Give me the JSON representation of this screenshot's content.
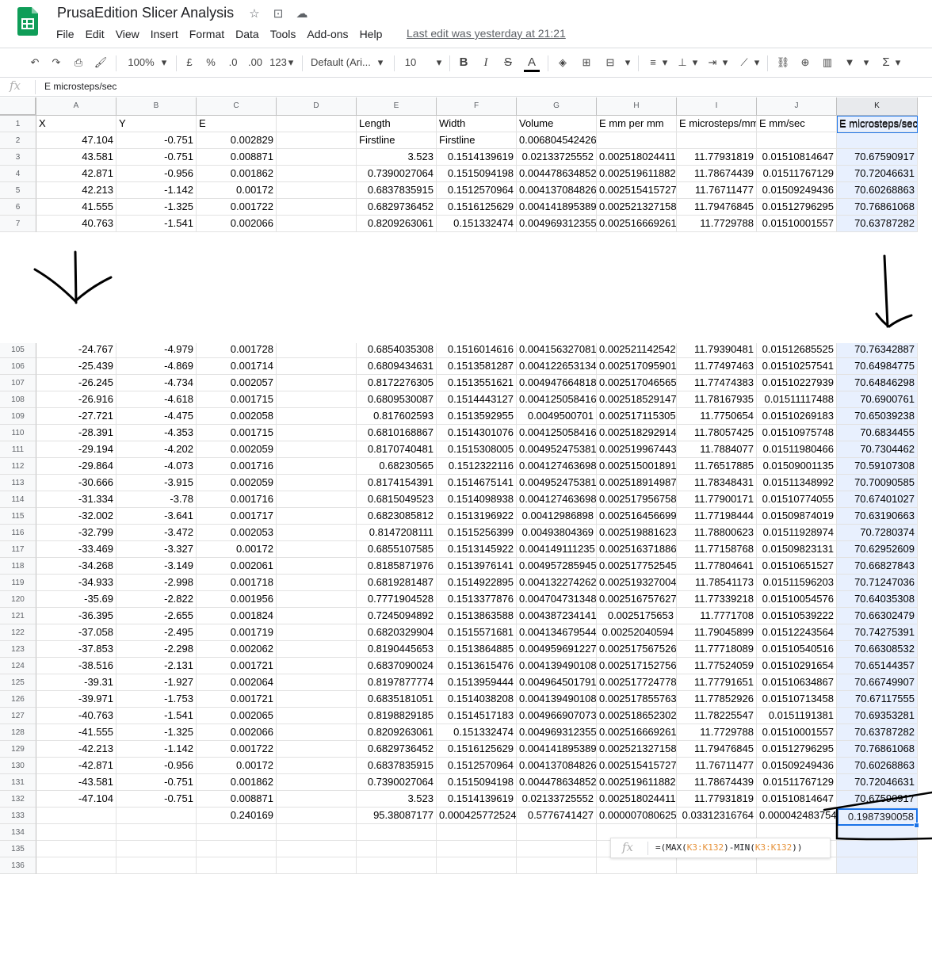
{
  "app": {
    "title": "PrusaEdition Slicer Analysis",
    "last_edit": "Last edit was yesterday at 21:21",
    "menu": [
      "File",
      "Edit",
      "View",
      "Insert",
      "Format",
      "Data",
      "Tools",
      "Add-ons",
      "Help"
    ],
    "title_icons": [
      "star-icon",
      "move-to-folder-icon",
      "cloud-status-icon"
    ]
  },
  "toolbar": {
    "zoom": "100%",
    "currency": "£",
    "percent": "%",
    "dec_less": ".0",
    "dec_more": ".00",
    "more_formats": "123",
    "font": "Default (Ari...",
    "font_size": "10",
    "bold": "B",
    "italic": "I",
    "strike": "S",
    "text_color": "A",
    "sum": "Σ"
  },
  "formula_bar": {
    "fx": "fx",
    "content": "E microsteps/sec"
  },
  "columns": [
    "A",
    "B",
    "C",
    "D",
    "E",
    "F",
    "G",
    "H",
    "I",
    "J",
    "K"
  ],
  "selected_column": "K",
  "header_row": {
    "num": "1",
    "cells": [
      "X",
      "Y",
      "E",
      "",
      "Length",
      "Width",
      "Volume",
      "E mm per mm",
      "E microsteps/mm",
      "E mm/sec",
      "E microsteps/sec"
    ]
  },
  "row2": {
    "num": "2",
    "cells": [
      "47.104",
      "-0.751",
      "0.002829",
      "",
      "Firstline",
      "Firstline",
      "0.006804542426",
      "",
      "",
      "",
      ""
    ]
  },
  "top_rows": [
    {
      "num": "3",
      "cells": [
        "43.581",
        "-0.751",
        "0.008871",
        "",
        "3.523",
        "0.1514139619",
        "0.02133725552",
        "0.002518024411",
        "11.77931819",
        "0.01510814647",
        "70.67590917"
      ]
    },
    {
      "num": "4",
      "cells": [
        "42.871",
        "-0.956",
        "0.001862",
        "",
        "0.7390027064",
        "0.1515094198",
        "0.004478634852",
        "0.002519611882",
        "11.78674439",
        "0.01511767129",
        "70.72046631"
      ]
    },
    {
      "num": "5",
      "cells": [
        "42.213",
        "-1.142",
        "0.00172",
        "",
        "0.6837835915",
        "0.1512570964",
        "0.004137084826",
        "0.002515415727",
        "11.76711477",
        "0.01509249436",
        "70.60268863"
      ]
    },
    {
      "num": "6",
      "cells": [
        "41.555",
        "-1.325",
        "0.001722",
        "",
        "0.6829736452",
        "0.1516125629",
        "0.004141895389",
        "0.002521327158",
        "11.79476845",
        "0.01512796295",
        "70.76861068"
      ]
    },
    {
      "num": "7",
      "cells": [
        "40.763",
        "-1.541",
        "0.002066",
        "",
        "0.8209263061",
        "0.151332474",
        "0.004969312355",
        "0.002516669261",
        "11.7729788",
        "0.01510001557",
        "70.63787282"
      ]
    }
  ],
  "bottom_rows": [
    {
      "num": "105",
      "cells": [
        "-24.767",
        "-4.979",
        "0.001728",
        "",
        "0.6854035308",
        "0.1516014616",
        "0.004156327081",
        "0.002521142542",
        "11.79390481",
        "0.01512685525",
        "70.76342887"
      ]
    },
    {
      "num": "106",
      "cells": [
        "-25.439",
        "-4.869",
        "0.001714",
        "",
        "0.6809434631",
        "0.1513581287",
        "0.004122653134",
        "0.002517095901",
        "11.77497463",
        "0.01510257541",
        "70.64984775"
      ]
    },
    {
      "num": "107",
      "cells": [
        "-26.245",
        "-4.734",
        "0.002057",
        "",
        "0.8172276305",
        "0.1513551621",
        "0.004947664818",
        "0.002517046565",
        "11.77474383",
        "0.01510227939",
        "70.64846298"
      ]
    },
    {
      "num": "108",
      "cells": [
        "-26.916",
        "-4.618",
        "0.001715",
        "",
        "0.6809530087",
        "0.1514443127",
        "0.004125058416",
        "0.002518529147",
        "11.78167935",
        "0.01511117488",
        "70.6900761"
      ]
    },
    {
      "num": "109",
      "cells": [
        "-27.721",
        "-4.475",
        "0.002058",
        "",
        "0.817602593",
        "0.1513592955",
        "0.0049500701",
        "0.002517115305",
        "11.7750654",
        "0.01510269183",
        "70.65039238"
      ]
    },
    {
      "num": "110",
      "cells": [
        "-28.391",
        "-4.353",
        "0.001715",
        "",
        "0.6810168867",
        "0.1514301076",
        "0.004125058416",
        "0.002518292914",
        "11.78057425",
        "0.01510975748",
        "70.6834455"
      ]
    },
    {
      "num": "111",
      "cells": [
        "-29.194",
        "-4.202",
        "0.002059",
        "",
        "0.8170740481",
        "0.1515308005",
        "0.004952475381",
        "0.002519967443",
        "11.7884077",
        "0.01511980466",
        "70.7304462"
      ]
    },
    {
      "num": "112",
      "cells": [
        "-29.864",
        "-4.073",
        "0.001716",
        "",
        "0.68230565",
        "0.1512322116",
        "0.004127463698",
        "0.002515001891",
        "11.76517885",
        "0.01509001135",
        "70.59107308"
      ]
    },
    {
      "num": "113",
      "cells": [
        "-30.666",
        "-3.915",
        "0.002059",
        "",
        "0.8174154391",
        "0.1514675141",
        "0.004952475381",
        "0.002518914987",
        "11.78348431",
        "0.01511348992",
        "70.70090585"
      ]
    },
    {
      "num": "114",
      "cells": [
        "-31.334",
        "-3.78",
        "0.001716",
        "",
        "0.6815049523",
        "0.1514098938",
        "0.004127463698",
        "0.002517956758",
        "11.77900171",
        "0.01510774055",
        "70.67401027"
      ]
    },
    {
      "num": "115",
      "cells": [
        "-32.002",
        "-3.641",
        "0.001717",
        "",
        "0.6823085812",
        "0.1513196922",
        "0.00412986898",
        "0.002516456699",
        "11.77198444",
        "0.01509874019",
        "70.63190663"
      ]
    },
    {
      "num": "116",
      "cells": [
        "-32.799",
        "-3.472",
        "0.002053",
        "",
        "0.8147208111",
        "0.1515256399",
        "0.00493804369",
        "0.002519881623",
        "11.78800623",
        "0.01511928974",
        "70.7280374"
      ]
    },
    {
      "num": "117",
      "cells": [
        "-33.469",
        "-3.327",
        "0.00172",
        "",
        "0.6855107585",
        "0.1513145922",
        "0.004149111235",
        "0.002516371886",
        "11.77158768",
        "0.01509823131",
        "70.62952609"
      ]
    },
    {
      "num": "118",
      "cells": [
        "-34.268",
        "-3.149",
        "0.002061",
        "",
        "0.8185871976",
        "0.1513976141",
        "0.004957285945",
        "0.002517752545",
        "11.77804641",
        "0.01510651527",
        "70.66827843"
      ]
    },
    {
      "num": "119",
      "cells": [
        "-34.933",
        "-2.998",
        "0.001718",
        "",
        "0.6819281487",
        "0.1514922895",
        "0.004132274262",
        "0.002519327004",
        "11.78541173",
        "0.01511596203",
        "70.71247036"
      ]
    },
    {
      "num": "120",
      "cells": [
        "-35.69",
        "-2.822",
        "0.001956",
        "",
        "0.7771904528",
        "0.1513377876",
        "0.004704731348",
        "0.002516757627",
        "11.77339218",
        "0.01510054576",
        "70.64035308"
      ]
    },
    {
      "num": "121",
      "cells": [
        "-36.395",
        "-2.655",
        "0.001824",
        "",
        "0.7245094892",
        "0.1513863588",
        "0.004387234141",
        "0.0025175653",
        "11.7771708",
        "0.01510539222",
        "70.66302479"
      ]
    },
    {
      "num": "122",
      "cells": [
        "-37.058",
        "-2.495",
        "0.001719",
        "",
        "0.6820329904",
        "0.1515571681",
        "0.004134679544",
        "0.00252040594",
        "11.79045899",
        "0.01512243564",
        "70.74275391"
      ]
    },
    {
      "num": "123",
      "cells": [
        "-37.853",
        "-2.298",
        "0.002062",
        "",
        "0.8190445653",
        "0.1513864885",
        "0.004959691227",
        "0.002517567526",
        "11.77718089",
        "0.01510540516",
        "70.66308532"
      ]
    },
    {
      "num": "124",
      "cells": [
        "-38.516",
        "-2.131",
        "0.001721",
        "",
        "0.6837090024",
        "0.1513615476",
        "0.004139490108",
        "0.002517152756",
        "11.77524059",
        "0.01510291654",
        "70.65144357"
      ]
    },
    {
      "num": "125",
      "cells": [
        "-39.31",
        "-1.927",
        "0.002064",
        "",
        "0.8197877774",
        "0.1513959444",
        "0.004964501791",
        "0.002517724778",
        "11.77791651",
        "0.01510634867",
        "70.66749907"
      ]
    },
    {
      "num": "126",
      "cells": [
        "-39.971",
        "-1.753",
        "0.001721",
        "",
        "0.6835181051",
        "0.1514038208",
        "0.004139490108",
        "0.002517855763",
        "11.77852926",
        "0.01510713458",
        "70.67117555"
      ]
    },
    {
      "num": "127",
      "cells": [
        "-40.763",
        "-1.541",
        "0.002065",
        "",
        "0.8198829185",
        "0.1514517183",
        "0.004966907073",
        "0.002518652302",
        "11.78225547",
        "0.0151191381",
        "70.69353281"
      ]
    },
    {
      "num": "128",
      "cells": [
        "-41.555",
        "-1.325",
        "0.002066",
        "",
        "0.8209263061",
        "0.151332474",
        "0.004969312355",
        "0.002516669261",
        "11.7729788",
        "0.01510001557",
        "70.63787282"
      ]
    },
    {
      "num": "129",
      "cells": [
        "-42.213",
        "-1.142",
        "0.001722",
        "",
        "0.6829736452",
        "0.1516125629",
        "0.004141895389",
        "0.002521327158",
        "11.79476845",
        "0.01512796295",
        "70.76861068"
      ]
    },
    {
      "num": "130",
      "cells": [
        "-42.871",
        "-0.956",
        "0.00172",
        "",
        "0.6837835915",
        "0.1512570964",
        "0.004137084826",
        "0.002515415727",
        "11.76711477",
        "0.01509249436",
        "70.60268863"
      ]
    },
    {
      "num": "131",
      "cells": [
        "-43.581",
        "-0.751",
        "0.001862",
        "",
        "0.7390027064",
        "0.1515094198",
        "0.004478634852",
        "0.002519611882",
        "11.78674439",
        "0.01511767129",
        "70.72046631"
      ]
    },
    {
      "num": "132",
      "cells": [
        "-47.104",
        "-0.751",
        "0.008871",
        "",
        "3.523",
        "0.1514139619",
        "0.02133725552",
        "0.002518024411",
        "11.77931819",
        "0.01510814647",
        "70.67590917"
      ]
    },
    {
      "num": "133",
      "cells": [
        "",
        "",
        "0.240169",
        "",
        "95.38087177",
        "0.000425772524",
        "0.5776741427",
        "0.000007080625",
        "0.03312316764",
        "0.000042483754",
        "0.1987390058"
      ]
    },
    {
      "num": "134",
      "cells": [
        "",
        "",
        "",
        "",
        "",
        "",
        "",
        "",
        "",
        "",
        ""
      ]
    },
    {
      "num": "135",
      "cells": [
        "",
        "",
        "",
        "",
        "",
        "",
        "",
        "",
        "",
        "",
        ""
      ]
    },
    {
      "num": "136",
      "cells": [
        "",
        "",
        "",
        "",
        "",
        "",
        "",
        "",
        "",
        "",
        ""
      ]
    }
  ],
  "tooltip": {
    "fx": "fx",
    "prefix": "=(MAX(",
    "range1": "K3:K132",
    "middle": ")-MIN(",
    "range2": "K3:K132",
    "suffix": "))"
  },
  "selected_cell_value": "0.1987390058"
}
